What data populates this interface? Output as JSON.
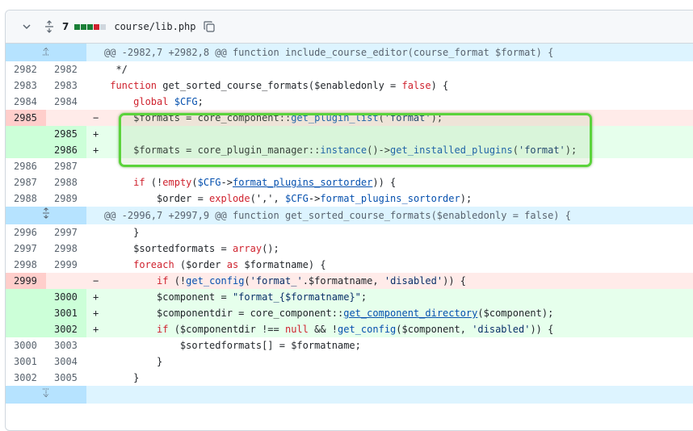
{
  "file": {
    "changes_count": "7",
    "path": "course/lib.php",
    "diffstat_colors": [
      "#1a7f37",
      "#1a7f37",
      "#1a7f37",
      "#cf222e",
      "#d0d7de"
    ]
  },
  "hunks": [
    {
      "header": "@@ -2982,7 +2982,8 @@ function include_course_editor(course_format $format) {",
      "lines": [
        {
          "type": "ctx",
          "old": "2982",
          "new": "2982",
          "sign": "",
          "segments": [
            {
              "t": "  */",
              "c": ""
            }
          ]
        },
        {
          "type": "ctx",
          "old": "2983",
          "new": "2983",
          "sign": "",
          "segments": [
            {
              "t": " ",
              "c": ""
            },
            {
              "t": "function",
              "c": "kw"
            },
            {
              "t": " ",
              "c": ""
            },
            {
              "t": "get_sorted_course_formats",
              "c": "fn"
            },
            {
              "t": "($enabledonly = ",
              "c": ""
            },
            {
              "t": "false",
              "c": "kw"
            },
            {
              "t": ") {",
              "c": ""
            }
          ]
        },
        {
          "type": "ctx",
          "old": "2984",
          "new": "2984",
          "sign": "",
          "segments": [
            {
              "t": "     ",
              "c": ""
            },
            {
              "t": "global",
              "c": "kw"
            },
            {
              "t": " ",
              "c": ""
            },
            {
              "t": "$CFG",
              "c": "link2"
            },
            {
              "t": ";",
              "c": ""
            }
          ]
        },
        {
          "type": "del",
          "old": "2985",
          "new": "",
          "sign": "−",
          "segments": [
            {
              "t": "     $formats = core_component::",
              "c": ""
            },
            {
              "t": "get_plugin_list",
              "c": "link2"
            },
            {
              "t": "(",
              "c": ""
            },
            {
              "t": "'format'",
              "c": "str"
            },
            {
              "t": ");",
              "c": ""
            }
          ]
        },
        {
          "type": "add",
          "old": "",
          "new": "2985",
          "sign": "+",
          "segments": [
            {
              "t": "",
              "c": ""
            }
          ]
        },
        {
          "type": "add",
          "old": "",
          "new": "2986",
          "sign": "+",
          "segments": [
            {
              "t": "     $formats = core_plugin_manager::",
              "c": ""
            },
            {
              "t": "instance",
              "c": "link2"
            },
            {
              "t": "()->",
              "c": ""
            },
            {
              "t": "get_installed_plugins",
              "c": "link2"
            },
            {
              "t": "(",
              "c": ""
            },
            {
              "t": "'format'",
              "c": "str"
            },
            {
              "t": ");",
              "c": ""
            }
          ]
        },
        {
          "type": "ctx",
          "old": "2986",
          "new": "2987",
          "sign": "",
          "segments": [
            {
              "t": "",
              "c": ""
            }
          ]
        },
        {
          "type": "ctx",
          "old": "2987",
          "new": "2988",
          "sign": "",
          "segments": [
            {
              "t": "     ",
              "c": ""
            },
            {
              "t": "if",
              "c": "kw"
            },
            {
              "t": " (!",
              "c": ""
            },
            {
              "t": "empty",
              "c": "kw"
            },
            {
              "t": "(",
              "c": ""
            },
            {
              "t": "$CFG",
              "c": "link2"
            },
            {
              "t": "->",
              "c": ""
            },
            {
              "t": "format_plugins_sortorder",
              "c": "link"
            },
            {
              "t": ")) {",
              "c": ""
            }
          ]
        },
        {
          "type": "ctx",
          "old": "2988",
          "new": "2989",
          "sign": "",
          "segments": [
            {
              "t": "         $order = ",
              "c": ""
            },
            {
              "t": "explode",
              "c": "kw"
            },
            {
              "t": "(',', ",
              "c": ""
            },
            {
              "t": "$CFG",
              "c": "link2"
            },
            {
              "t": "->",
              "c": ""
            },
            {
              "t": "format_plugins_sortorder",
              "c": "link2"
            },
            {
              "t": ");",
              "c": ""
            }
          ]
        }
      ]
    },
    {
      "header": "@@ -2996,7 +2997,9 @@ function get_sorted_course_formats($enabledonly = false) {",
      "lines": [
        {
          "type": "ctx",
          "old": "2996",
          "new": "2997",
          "sign": "",
          "segments": [
            {
              "t": "     }",
              "c": ""
            }
          ]
        },
        {
          "type": "ctx",
          "old": "2997",
          "new": "2998",
          "sign": "",
          "segments": [
            {
              "t": "     $sortedformats = ",
              "c": ""
            },
            {
              "t": "array",
              "c": "kw"
            },
            {
              "t": "();",
              "c": ""
            }
          ]
        },
        {
          "type": "ctx",
          "old": "2998",
          "new": "2999",
          "sign": "",
          "segments": [
            {
              "t": "     ",
              "c": ""
            },
            {
              "t": "foreach",
              "c": "kw"
            },
            {
              "t": " ($order ",
              "c": ""
            },
            {
              "t": "as",
              "c": "kw"
            },
            {
              "t": " $formatname) {",
              "c": ""
            }
          ]
        },
        {
          "type": "del",
          "old": "2999",
          "new": "",
          "sign": "−",
          "segments": [
            {
              "t": "         ",
              "c": ""
            },
            {
              "t": "if",
              "c": "kw"
            },
            {
              "t": " (!",
              "c": ""
            },
            {
              "t": "get_config",
              "c": "link2"
            },
            {
              "t": "(",
              "c": ""
            },
            {
              "t": "'format_'",
              "c": "str"
            },
            {
              "t": ".$formatname, ",
              "c": ""
            },
            {
              "t": "'disabled'",
              "c": "str"
            },
            {
              "t": ")) {",
              "c": ""
            }
          ]
        },
        {
          "type": "add",
          "old": "",
          "new": "3000",
          "sign": "+",
          "segments": [
            {
              "t": "         $component = ",
              "c": ""
            },
            {
              "t": "\"format_{$formatname}\"",
              "c": "str"
            },
            {
              "t": ";",
              "c": ""
            }
          ]
        },
        {
          "type": "add",
          "old": "",
          "new": "3001",
          "sign": "+",
          "segments": [
            {
              "t": "         $componentdir = core_component::",
              "c": ""
            },
            {
              "t": "get_component_directory",
              "c": "link"
            },
            {
              "t": "($component);",
              "c": ""
            }
          ]
        },
        {
          "type": "add",
          "old": "",
          "new": "3002",
          "sign": "+",
          "segments": [
            {
              "t": "         ",
              "c": ""
            },
            {
              "t": "if",
              "c": "kw"
            },
            {
              "t": " ($componentdir !== ",
              "c": ""
            },
            {
              "t": "null",
              "c": "kw"
            },
            {
              "t": " && !",
              "c": ""
            },
            {
              "t": "get_config",
              "c": "link2"
            },
            {
              "t": "($component, ",
              "c": ""
            },
            {
              "t": "'disabled'",
              "c": "str"
            },
            {
              "t": ")) {",
              "c": ""
            }
          ]
        },
        {
          "type": "ctx",
          "old": "3000",
          "new": "3003",
          "sign": "",
          "segments": [
            {
              "t": "             $sortedformats[] = $formatname;",
              "c": ""
            }
          ]
        },
        {
          "type": "ctx",
          "old": "3001",
          "new": "3004",
          "sign": "",
          "segments": [
            {
              "t": "         }",
              "c": ""
            }
          ]
        },
        {
          "type": "ctx",
          "old": "3002",
          "new": "3005",
          "sign": "",
          "segments": [
            {
              "t": "     }",
              "c": ""
            }
          ]
        }
      ]
    }
  ]
}
